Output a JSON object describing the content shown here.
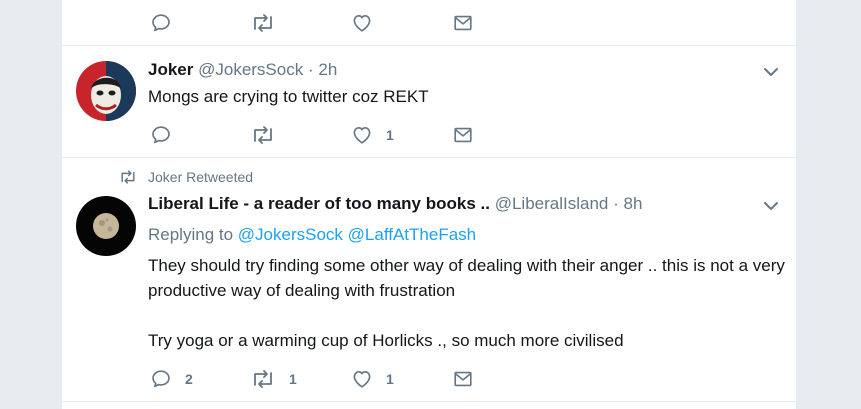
{
  "tweets": [
    {
      "replies": "",
      "retweets": "",
      "likes": ""
    },
    {
      "name": "Joker",
      "handle": "@JokersSock",
      "separator": "·",
      "time": "2h",
      "text": "Mongs are crying to twitter coz REKT",
      "replies": "",
      "retweets": "",
      "likes": "1"
    },
    {
      "retweet_context": "Joker Retweeted",
      "name": "Liberal Life - a reader of too many books ..",
      "handle": "@LiberalIsland",
      "separator": "·",
      "time": "8h",
      "replying_prefix": "Replying to",
      "replying_to": [
        "@JokersSock",
        "@LaffAtTheFash"
      ],
      "text": "They should try finding some other way of dealing with their anger .. this is not a very productive way of dealing with frustration\n\nTry yoga or a warming cup of Horlicks ., so much more civilised",
      "replies": "2",
      "retweets": "1",
      "likes": "1"
    }
  ],
  "icons": {
    "reply": "reply-icon",
    "retweet": "retweet-icon",
    "like": "heart-icon",
    "message": "envelope-icon",
    "caret": "chevron-down-icon"
  },
  "colors": {
    "background": "#e6ecf0",
    "text": "#14171a",
    "secondary": "#657786",
    "link": "#1da1f2"
  }
}
